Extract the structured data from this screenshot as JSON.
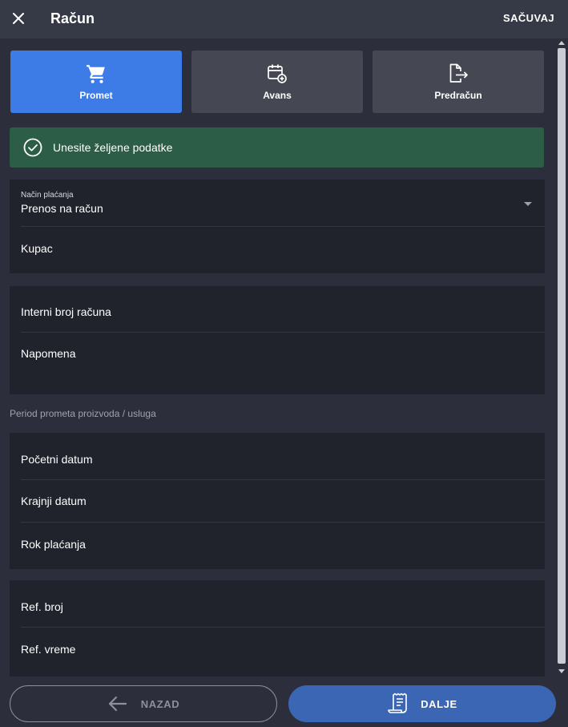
{
  "header": {
    "title": "Račun",
    "save_label": "SAČUVAJ"
  },
  "type_tabs": [
    {
      "label": "Promet",
      "icon": "cart-icon",
      "active": true
    },
    {
      "label": "Avans",
      "icon": "calendar-add-icon",
      "active": false
    },
    {
      "label": "Predračun",
      "icon": "document-export-icon",
      "active": false
    }
  ],
  "status": {
    "message": "Unesite željene podatke",
    "icon": "check-circle-icon"
  },
  "payment": {
    "method_label": "Način plaćanja",
    "method_value": "Prenos na račun",
    "customer_label": "Kupac"
  },
  "invoice": {
    "internal_number_label": "Interni broj računa",
    "note_label": "Napomena"
  },
  "period": {
    "section_label": "Period prometa proizvoda / usluga",
    "start_label": "Početni datum",
    "end_label": "Krajnji datum",
    "due_label": "Rok plaćanja"
  },
  "reference": {
    "number_label": "Ref. broj",
    "time_label": "Ref. vreme"
  },
  "footer": {
    "back_label": "NAZAD",
    "next_label": "DALJE"
  },
  "colors": {
    "background": "#2c2f3b",
    "header": "#363a46",
    "card": "#21232c",
    "active_tab": "#3d7ce6",
    "inactive_tab": "#454853",
    "success": "#2c5d46",
    "next_button": "#3b66b3"
  }
}
